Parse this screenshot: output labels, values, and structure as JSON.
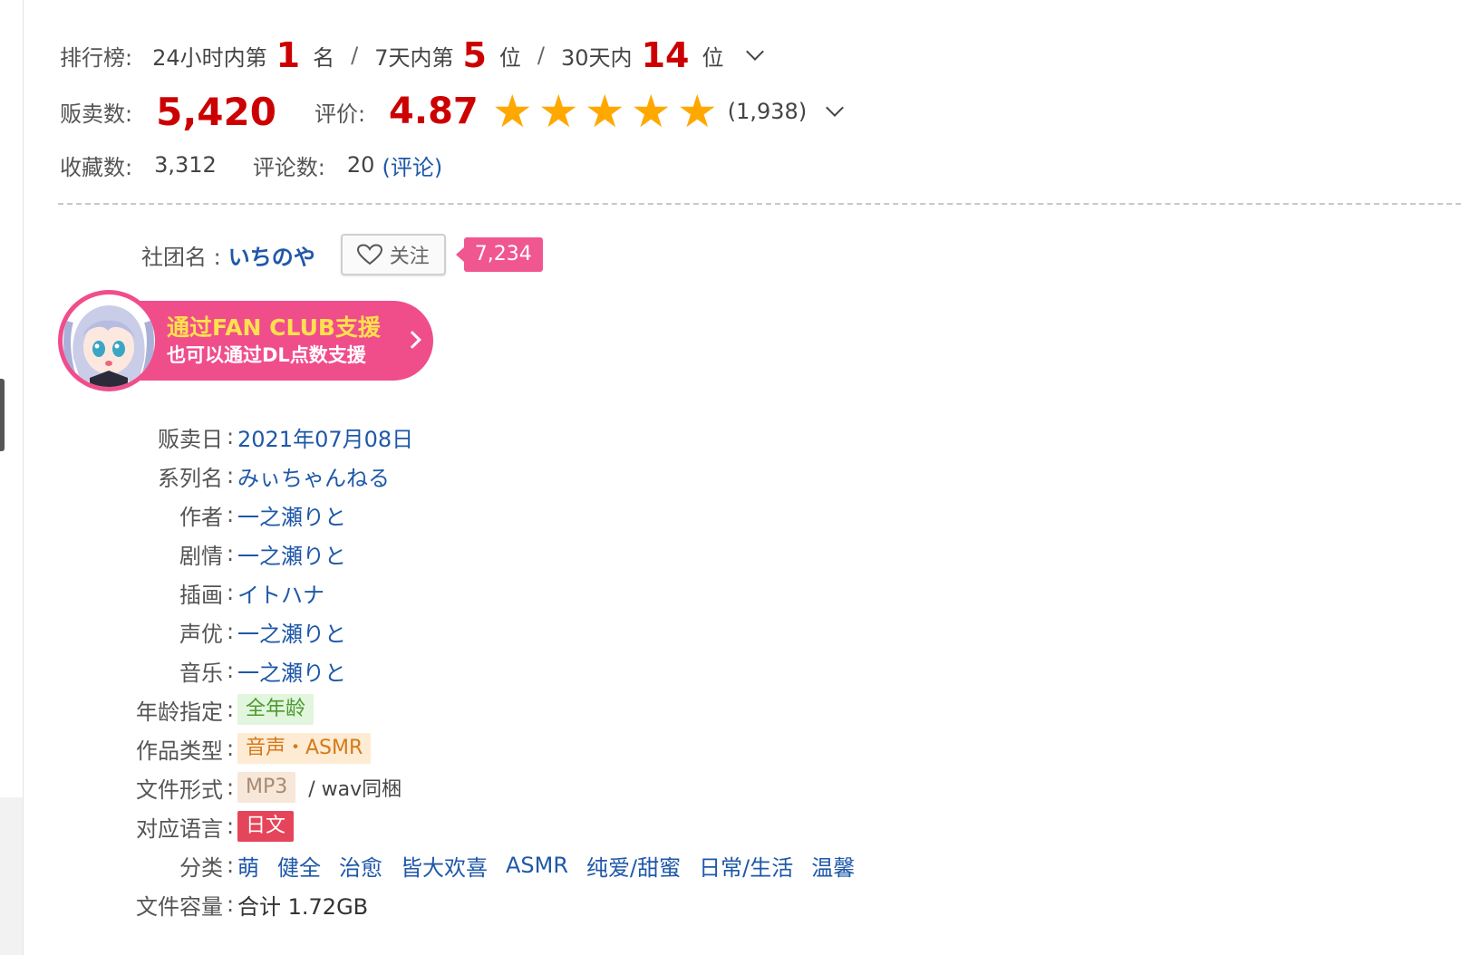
{
  "stats": {
    "ranking_label": "排行榜:",
    "rank_24h_prefix": "24小时内第",
    "rank_24h": "1",
    "rank_24h_suffix": "名",
    "rank_7d_prefix": "7天内第",
    "rank_7d": "5",
    "rank_7d_suffix": "位",
    "rank_30d_prefix": "30天内",
    "rank_30d": "14",
    "rank_30d_suffix": "位",
    "slash": "/",
    "sales_label": "贩卖数:",
    "sales_value": "5,420",
    "rating_label": "评价:",
    "rating_value": "4.87",
    "rating_stars": 5,
    "rating_count": "(1,938)",
    "favorites_label": "收藏数:",
    "favorites_value": "3,312",
    "comments_label": "评论数:",
    "comments_value": "20",
    "comments_link": "(评论)"
  },
  "circle": {
    "label": "社团名 :",
    "name": "いちのや",
    "follow_label": "关注",
    "follow_count": "7,234"
  },
  "fanclub": {
    "line1": "通过FAN CLUB支援",
    "line2": "也可以通过DL点数支援"
  },
  "info": {
    "colon": ":",
    "release_date": {
      "label": "贩卖日",
      "value": "2021年07月08日"
    },
    "series": {
      "label": "系列名",
      "value": "みぃちゃんねる"
    },
    "author": {
      "label": "作者",
      "value": "一之瀬りと"
    },
    "scenario": {
      "label": "剧情",
      "value": "一之瀬りと"
    },
    "illustration": {
      "label": "插画",
      "value": "イトハナ"
    },
    "voice": {
      "label": "声优",
      "value": "一之瀬りと"
    },
    "music": {
      "label": "音乐",
      "value": "一之瀬りと"
    },
    "age_rating": {
      "label": "年龄指定",
      "value": "全年龄"
    },
    "work_type": {
      "label": "作品类型",
      "value": "音声・ASMR"
    },
    "file_format": {
      "label": "文件形式",
      "value": "MP3",
      "extra": "/ wav同梱"
    },
    "language": {
      "label": "对应语言",
      "value": "日文"
    },
    "genres": {
      "label": "分类",
      "items": [
        "萌",
        "健全",
        "治愈",
        "皆大欢喜",
        "ASMR",
        "纯爱/甜蜜",
        "日常/生活",
        "温馨"
      ]
    },
    "file_size": {
      "label": "文件容量",
      "value": "合计 1.72GB"
    }
  },
  "colors": {
    "accent_red": "#cc0000",
    "link_blue": "#1f58a8",
    "star": "#ffa800",
    "pink": "#f04d8b",
    "fanclub_yellow": "#ffe14d"
  },
  "icons": [
    "chevron-down-icon",
    "star-icon",
    "heart-icon",
    "chevron-right-icon"
  ]
}
